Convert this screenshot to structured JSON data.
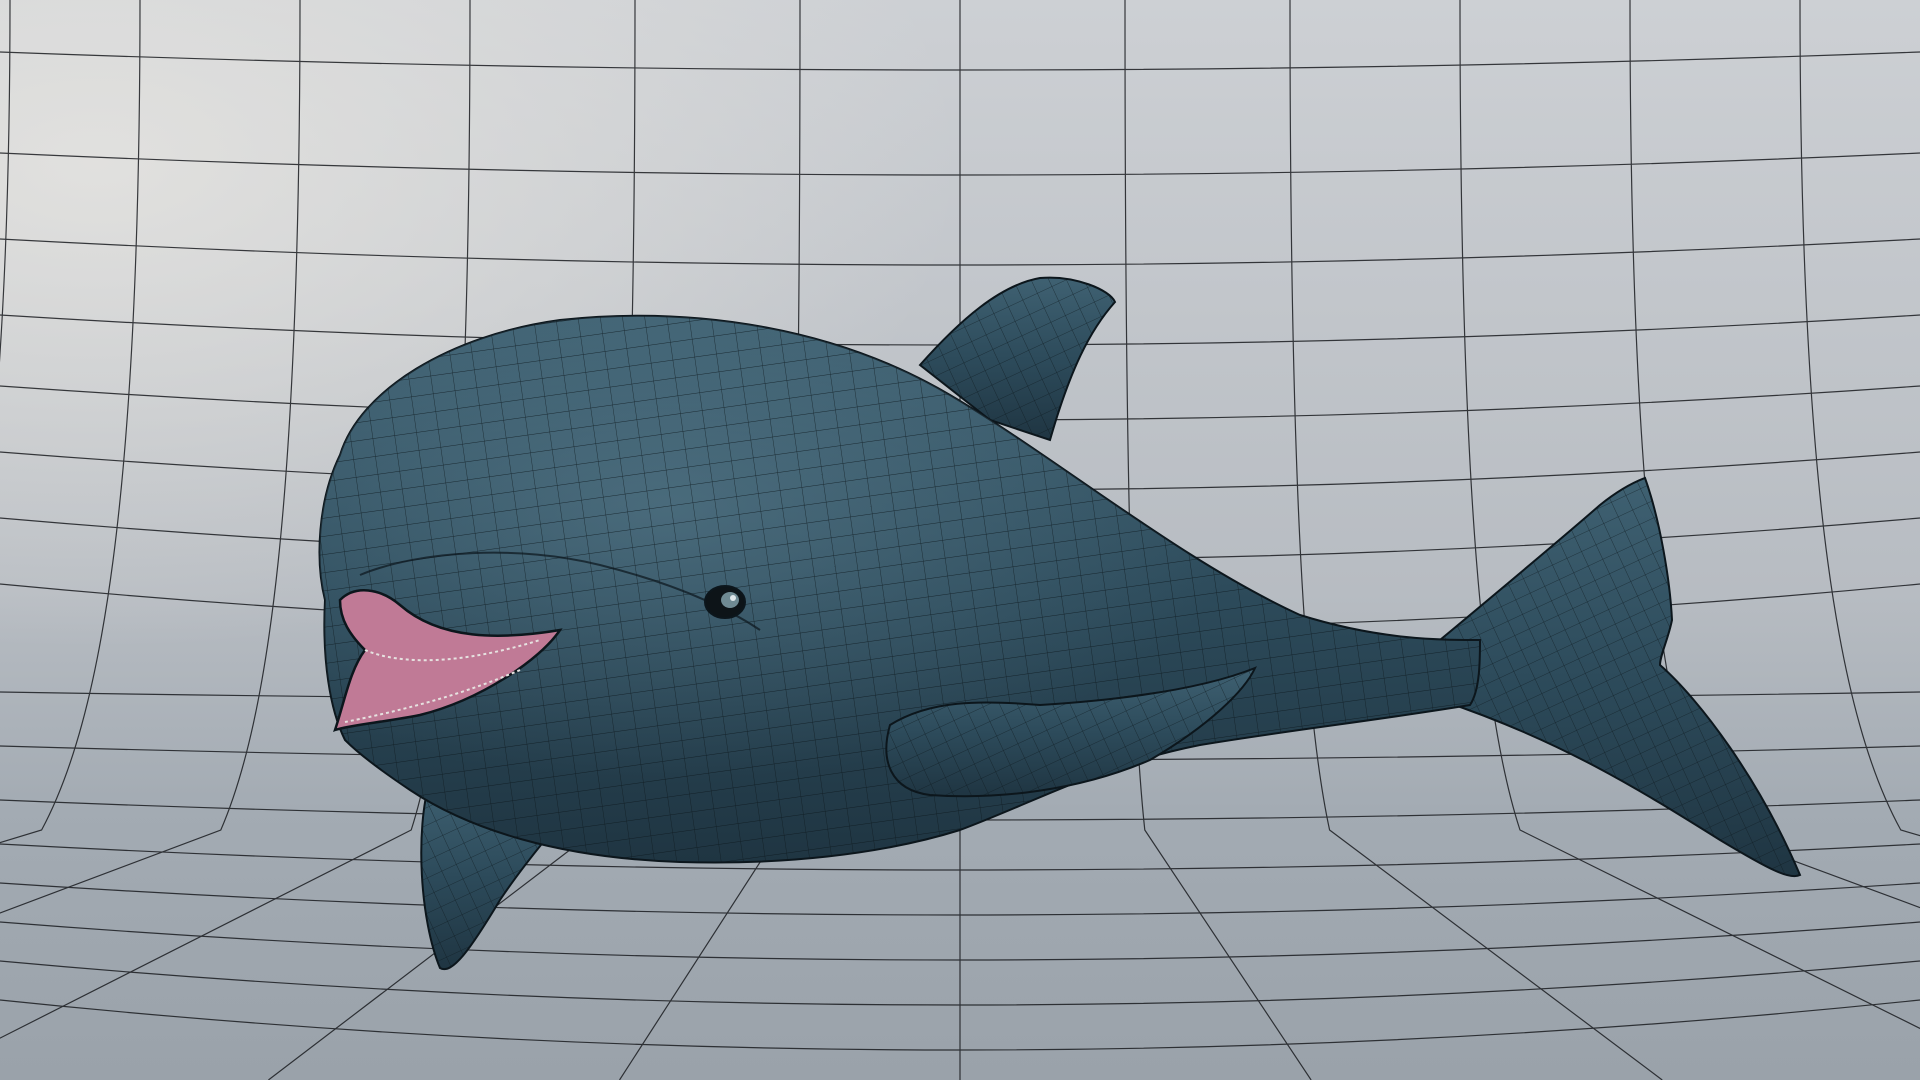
{
  "scene": {
    "subject_icon": "dolphin-icon",
    "colors": {
      "backdrop_top": "#cdd0d4",
      "backdrop_mid": "#b7bcc2",
      "floor": "#a3abb3",
      "grid_line": "#1a1c20",
      "body_top": "#3f6172",
      "body_mid": "#2d4b5b",
      "body_bottom": "#1f3542",
      "mouth_inner": "#c07a96",
      "mesh_line": "#0c161c"
    }
  }
}
